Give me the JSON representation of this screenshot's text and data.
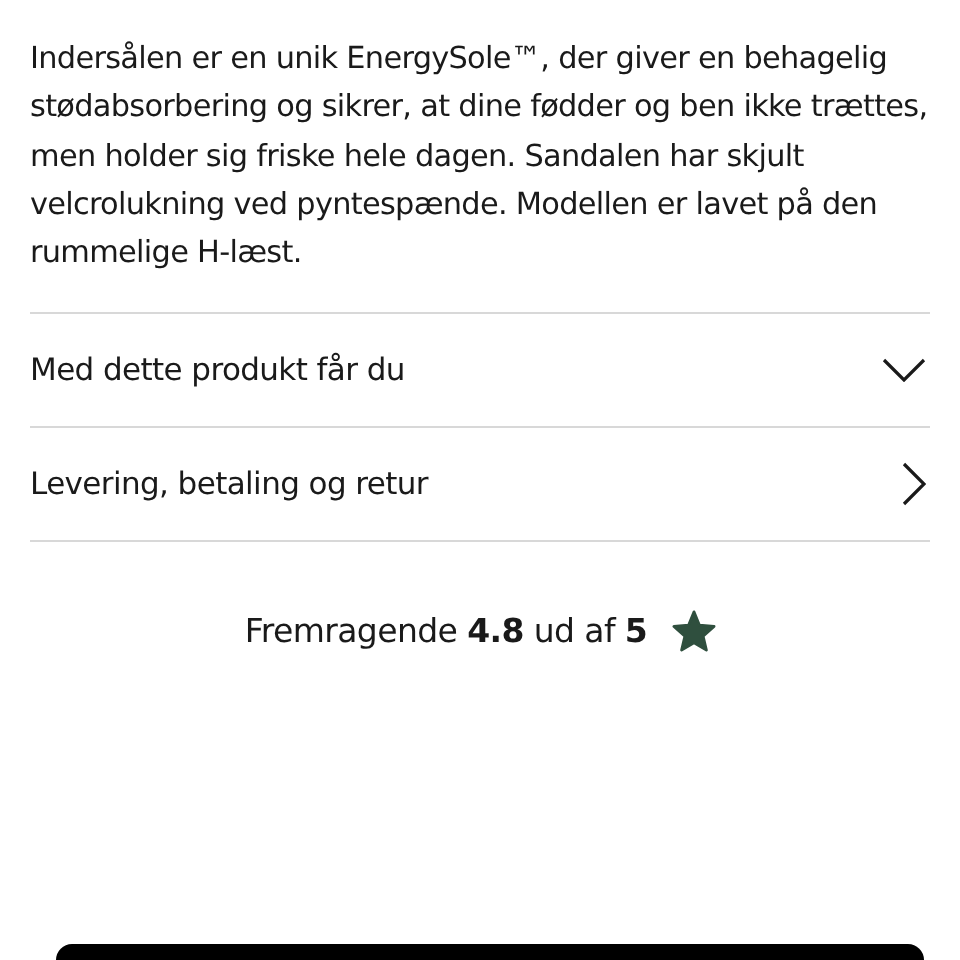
{
  "description": "Indersålen er en unik EnergySole™, der giver en behagelig stødabsorbering og sikrer, at dine fødder og ben ikke trættes, men holder sig friske hele dagen. Sandalen har skjult velcrolukning ved pyntespænde. Modellen er lavet på den rummelige H-læst.",
  "sections": [
    {
      "label": "Med dette produkt får du",
      "kind": "accordion",
      "expanded": false
    },
    {
      "label": "Levering, betaling og retur",
      "kind": "link"
    }
  ],
  "rating": {
    "text": "Fremragende **4.8** ud af **5**"
  }
}
